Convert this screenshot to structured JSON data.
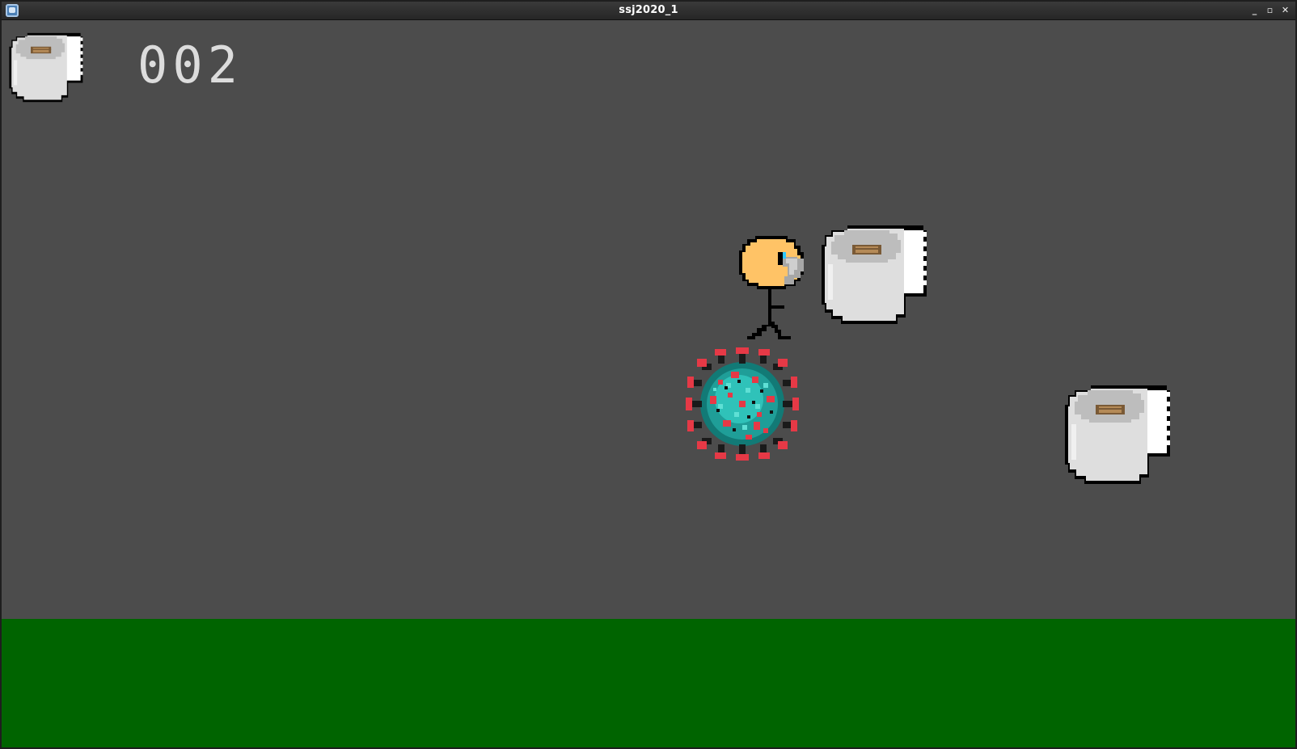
{
  "window": {
    "title": "ssj2020_1",
    "controls": {
      "minimize": "_",
      "maximize": "▫",
      "close": "✕"
    }
  },
  "hud": {
    "icon": "toilet-paper-icon",
    "score": "002"
  },
  "scene": {
    "background_color": "#4c4c4c",
    "ground_color": "#006400",
    "objects": [
      {
        "name": "player",
        "icon": "stick-figure-player"
      },
      {
        "name": "virus",
        "icon": "coronavirus-enemy"
      },
      {
        "name": "toilet-paper-1",
        "icon": "toilet-paper-icon"
      },
      {
        "name": "toilet-paper-2",
        "icon": "toilet-paper-icon"
      }
    ]
  }
}
